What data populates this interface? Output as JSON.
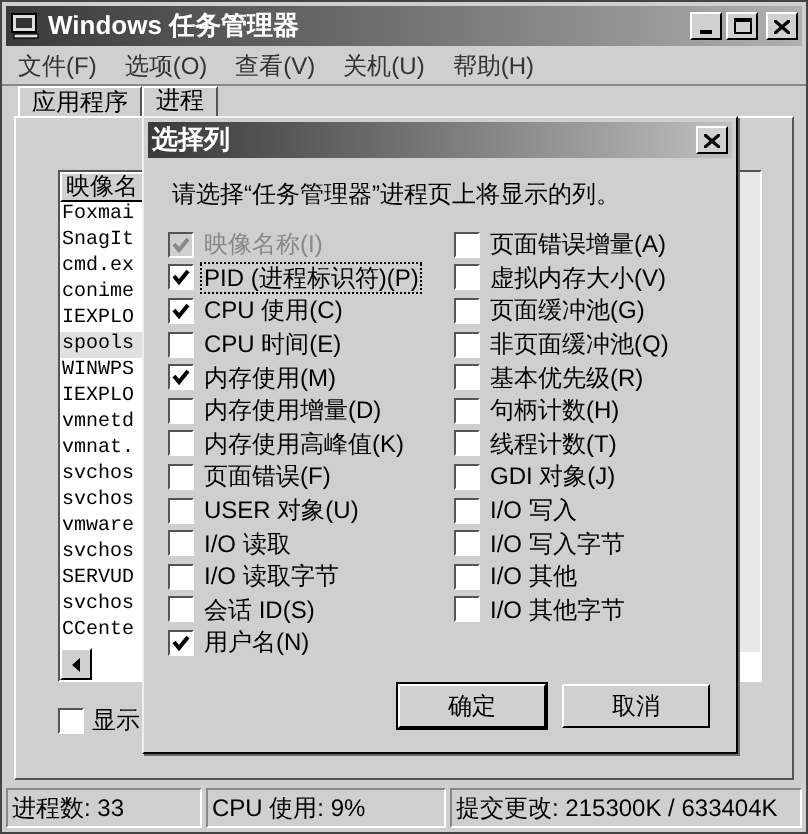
{
  "window": {
    "title": "Windows 任务管理器"
  },
  "menu": [
    "文件(F)",
    "选项(O)",
    "查看(V)",
    "关机(U)",
    "帮助(H)"
  ],
  "tabs": [
    {
      "label": "应用程序",
      "selected": false
    },
    {
      "label": "进程",
      "selected": true
    }
  ],
  "process_list": {
    "column": "映像名",
    "rows": [
      {
        "name": "Foxmai",
        "selected": false
      },
      {
        "name": "SnagIt",
        "selected": false
      },
      {
        "name": "cmd.ex",
        "selected": false
      },
      {
        "name": "conime",
        "selected": false
      },
      {
        "name": "IEXPLO",
        "selected": false
      },
      {
        "name": "spools",
        "selected": true
      },
      {
        "name": "WINWPS",
        "selected": false
      },
      {
        "name": "IEXPLO",
        "selected": false
      },
      {
        "name": "vmnetd",
        "selected": false
      },
      {
        "name": "vmnat.",
        "selected": false
      },
      {
        "name": "svchos",
        "selected": false
      },
      {
        "name": "svchos",
        "selected": false
      },
      {
        "name": "vmware",
        "selected": false
      },
      {
        "name": "svchos",
        "selected": false
      },
      {
        "name": "SERVUD",
        "selected": false
      },
      {
        "name": "svchos",
        "selected": false
      },
      {
        "name": "CCente",
        "selected": false
      }
    ]
  },
  "show_all_checkbox": {
    "label": "显示",
    "checked": false
  },
  "dialog": {
    "title": "选择列",
    "message": "请选择“任务管理器”进程页上将显示的列。",
    "columns": [
      [
        {
          "label": "映像名称(I)",
          "checked": true,
          "disabled": true,
          "focused": false
        },
        {
          "label": "PID (进程标识符)(P)",
          "checked": true,
          "disabled": false,
          "focused": true
        },
        {
          "label": "CPU 使用(C)",
          "checked": true,
          "disabled": false,
          "focused": false
        },
        {
          "label": "CPU 时间(E)",
          "checked": false,
          "disabled": false,
          "focused": false
        },
        {
          "label": "内存使用(M)",
          "checked": true,
          "disabled": false,
          "focused": false
        },
        {
          "label": "内存使用增量(D)",
          "checked": false,
          "disabled": false,
          "focused": false
        },
        {
          "label": "内存使用高峰值(K)",
          "checked": false,
          "disabled": false,
          "focused": false
        },
        {
          "label": "页面错误(F)",
          "checked": false,
          "disabled": false,
          "focused": false
        },
        {
          "label": "USER 对象(U)",
          "checked": false,
          "disabled": false,
          "focused": false
        },
        {
          "label": "I/O 读取",
          "checked": false,
          "disabled": false,
          "focused": false
        },
        {
          "label": "I/O 读取字节",
          "checked": false,
          "disabled": false,
          "focused": false
        },
        {
          "label": "会话 ID(S)",
          "checked": false,
          "disabled": false,
          "focused": false
        },
        {
          "label": "用户名(N)",
          "checked": true,
          "disabled": false,
          "focused": false
        }
      ],
      [
        {
          "label": "页面错误增量(A)",
          "checked": false,
          "disabled": false,
          "focused": false
        },
        {
          "label": "虚拟内存大小(V)",
          "checked": false,
          "disabled": false,
          "focused": false
        },
        {
          "label": "页面缓冲池(G)",
          "checked": false,
          "disabled": false,
          "focused": false
        },
        {
          "label": "非页面缓冲池(Q)",
          "checked": false,
          "disabled": false,
          "focused": false
        },
        {
          "label": "基本优先级(R)",
          "checked": false,
          "disabled": false,
          "focused": false
        },
        {
          "label": "句柄计数(H)",
          "checked": false,
          "disabled": false,
          "focused": false
        },
        {
          "label": "线程计数(T)",
          "checked": false,
          "disabled": false,
          "focused": false
        },
        {
          "label": "GDI 对象(J)",
          "checked": false,
          "disabled": false,
          "focused": false
        },
        {
          "label": "I/O 写入",
          "checked": false,
          "disabled": false,
          "focused": false
        },
        {
          "label": "I/O 写入字节",
          "checked": false,
          "disabled": false,
          "focused": false
        },
        {
          "label": "I/O 其他",
          "checked": false,
          "disabled": false,
          "focused": false
        },
        {
          "label": "I/O 其他字节",
          "checked": false,
          "disabled": false,
          "focused": false
        }
      ]
    ],
    "buttons": [
      "确定",
      "取消"
    ]
  },
  "status_bar": [
    "进程数: 33",
    "CPU 使用: 9%",
    "提交更改: 215300K / 633404K"
  ]
}
